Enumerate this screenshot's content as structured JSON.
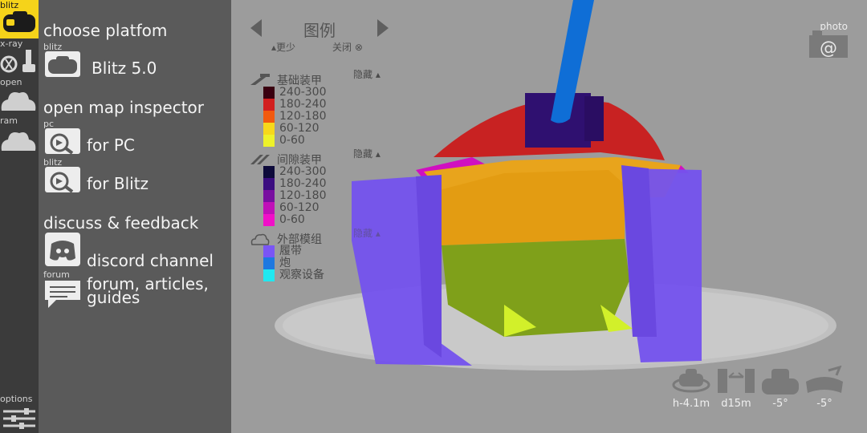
{
  "rail": {
    "items": [
      {
        "label": "blitz"
      },
      {
        "label": "x-ray"
      },
      {
        "label": "open"
      },
      {
        "label": "ram"
      },
      {
        "label": "options"
      }
    ]
  },
  "menu": {
    "choose_platform": "choose platfom",
    "blitz_small": "blitz",
    "blitz_version": "Blitz 5.0",
    "open_map_inspector": "open map inspector",
    "pc_small": "pc",
    "for_pc": "for PC",
    "blitz_small2": "blitz",
    "for_blitz": "for Blitz",
    "discuss_feedback": "discuss & feedback",
    "discord_channel": "discord channel",
    "forum_small": "forum",
    "forum_line1": "forum, articles,",
    "forum_line2": "guides"
  },
  "legend": {
    "title": "图例",
    "less": "更少",
    "close": "关闭",
    "groups": [
      {
        "title": "基础装甲",
        "hide": "隐藏",
        "rows": [
          {
            "label": "240-300",
            "color": "#3a0010"
          },
          {
            "label": "180-240",
            "color": "#d21f1f"
          },
          {
            "label": "120-180",
            "color": "#f25a0e"
          },
          {
            "label": "60-120",
            "color": "#f7d81b"
          },
          {
            "label": "0-60",
            "color": "#eef22a"
          }
        ]
      },
      {
        "title": "间隙装甲",
        "hide": "隐藏",
        "rows": [
          {
            "label": "240-300",
            "color": "#0d0a3a"
          },
          {
            "label": "180-240",
            "color": "#3b0d80"
          },
          {
            "label": "120-180",
            "color": "#780ea0"
          },
          {
            "label": "60-120",
            "color": "#c00fb8"
          },
          {
            "label": "0-60",
            "color": "#f010c8"
          }
        ]
      },
      {
        "title": "外部模组",
        "hide": "隐藏",
        "rows": [
          {
            "label": "履带",
            "color": "#7a55f5"
          },
          {
            "label": "炮",
            "color": "#1e78e0"
          },
          {
            "label": "观察设备",
            "color": "#20e8f0"
          }
        ]
      }
    ]
  },
  "photo": {
    "label": "photo"
  },
  "controls": [
    {
      "label": "h-4.1m"
    },
    {
      "label": "d15m"
    },
    {
      "label": "-5°"
    },
    {
      "label": "-5°"
    }
  ],
  "colors": {
    "accent": "#f5d31a",
    "rail_bg": "#3b3b3b",
    "menu_bg": "#5a5a5a",
    "viewer_bg": "#9c9c9c"
  }
}
